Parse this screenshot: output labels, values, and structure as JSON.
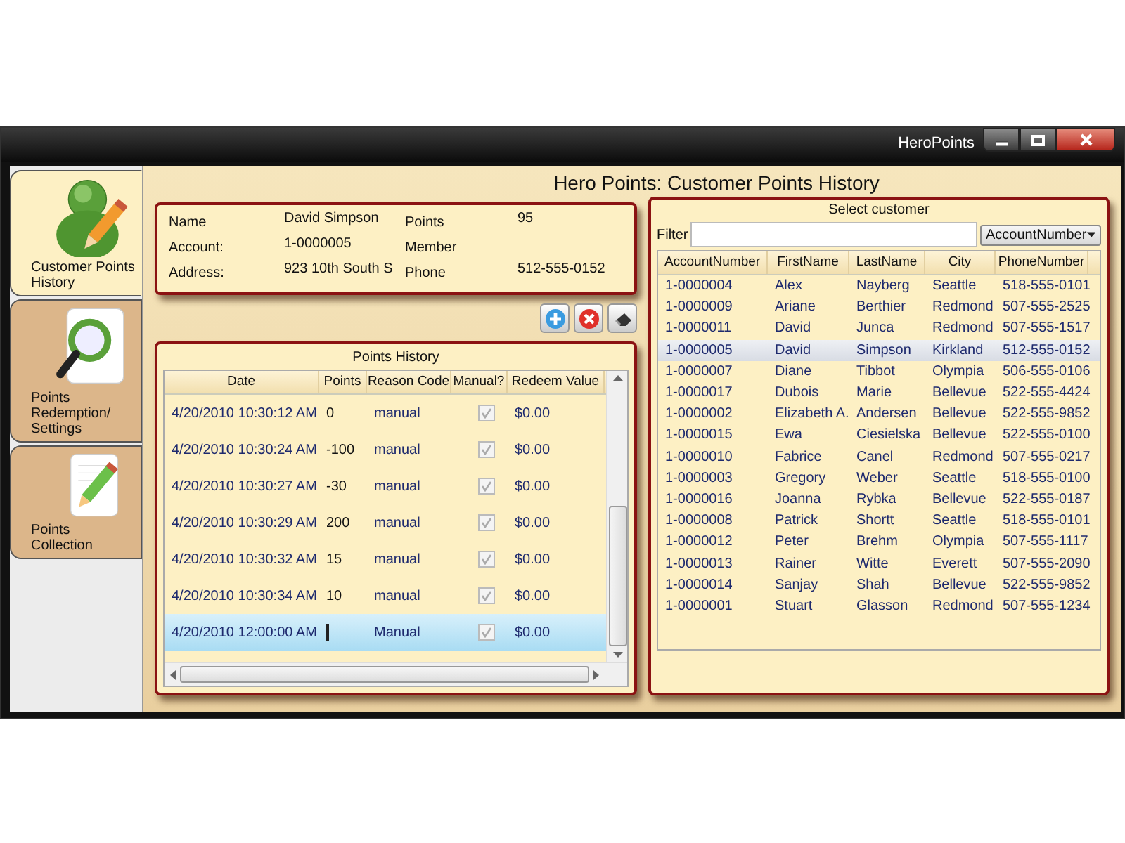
{
  "window": {
    "title": "HeroPoints"
  },
  "nav": [
    {
      "label": "Customer Points History",
      "kind": "person",
      "selected": true
    },
    {
      "label": "Points Redemption/ Settings",
      "kind": "search",
      "selected": false
    },
    {
      "label": "Points Collection",
      "kind": "pencil",
      "selected": false
    }
  ],
  "heading": "Hero Points: Customer Points History",
  "customer": {
    "left": [
      {
        "label": "Name",
        "value": "David Simpson"
      },
      {
        "label": "Account:",
        "value": "1-0000005"
      },
      {
        "label": "Address:",
        "value": "923 10th South S"
      }
    ],
    "right": [
      {
        "label": "Points",
        "value": "95"
      },
      {
        "label": "Member"
      },
      {
        "label": "Phone",
        "value": "512-555-0152"
      }
    ]
  },
  "toolbar": [
    {
      "kind": "add"
    },
    {
      "kind": "delete"
    },
    {
      "kind": "eraser"
    }
  ],
  "points_history": {
    "title": "Points History",
    "columns": [
      "Date",
      "Points",
      "Reason Code",
      "Manual?",
      "Redeem Value"
    ],
    "rows": [
      {
        "date": "4/20/2010 10:30:12 AM",
        "points": "0",
        "reason": "manual",
        "manual": true,
        "redeem": "$0.00",
        "selected": false,
        "editing": false
      },
      {
        "date": "4/20/2010 10:30:24 AM",
        "points": "-100",
        "reason": "manual",
        "manual": true,
        "redeem": "$0.00",
        "selected": false,
        "editing": false
      },
      {
        "date": "4/20/2010 10:30:27 AM",
        "points": "-30",
        "reason": "manual",
        "manual": true,
        "redeem": "$0.00",
        "selected": false,
        "editing": false
      },
      {
        "date": "4/20/2010 10:30:29 AM",
        "points": "200",
        "reason": "manual",
        "manual": true,
        "redeem": "$0.00",
        "selected": false,
        "editing": false
      },
      {
        "date": "4/20/2010 10:30:32 AM",
        "points": "15",
        "reason": "manual",
        "manual": true,
        "redeem": "$0.00",
        "selected": false,
        "editing": false
      },
      {
        "date": "4/20/2010 10:30:34 AM",
        "points": "10",
        "reason": "manual",
        "manual": true,
        "redeem": "$0.00",
        "selected": false,
        "editing": false
      },
      {
        "date": "4/20/2010 12:00:00 AM",
        "reason": "Manual",
        "manual": true,
        "redeem": "$0.00",
        "selected": true,
        "editing": true
      }
    ]
  },
  "customers": {
    "title": "Select customer",
    "filter_label": "Filter",
    "sort_by": "AccountNumber",
    "columns": [
      "AccountNumber",
      "FirstName",
      "LastName",
      "City",
      "PhoneNumber"
    ],
    "rows": [
      {
        "cells": [
          "1-0000004",
          "Alex",
          "Nayberg",
          "Seattle",
          "518-555-0101"
        ],
        "selected": false
      },
      {
        "cells": [
          "1-0000009",
          "Ariane",
          "Berthier",
          "Redmond",
          "507-555-2525"
        ],
        "selected": false
      },
      {
        "cells": [
          "1-0000011",
          "David",
          "Junca",
          "Redmond",
          "507-555-1517"
        ],
        "selected": false
      },
      {
        "cells": [
          "1-0000005",
          "David",
          "Simpson",
          "Kirkland",
          "512-555-0152"
        ],
        "selected": true
      },
      {
        "cells": [
          "1-0000007",
          "Diane",
          "Tibbot",
          "Olympia",
          "506-555-0106"
        ],
        "selected": false
      },
      {
        "cells": [
          "1-0000017",
          "Dubois",
          "Marie",
          "Bellevue",
          "522-555-4424"
        ],
        "selected": false
      },
      {
        "cells": [
          "1-0000002",
          "Elizabeth A.",
          "Andersen",
          "Bellevue",
          "522-555-9852"
        ],
        "selected": false
      },
      {
        "cells": [
          "1-0000015",
          "Ewa",
          "Ciesielska",
          "Bellevue",
          "522-555-0100"
        ],
        "selected": false
      },
      {
        "cells": [
          "1-0000010",
          "Fabrice",
          "Canel",
          "Redmond",
          "507-555-0217"
        ],
        "selected": false
      },
      {
        "cells": [
          "1-0000003",
          "Gregory",
          "Weber",
          "Seattle",
          "518-555-0100"
        ],
        "selected": false
      },
      {
        "cells": [
          "1-0000016",
          "Joanna",
          "Rybka",
          "Bellevue",
          "522-555-0187"
        ],
        "selected": false
      },
      {
        "cells": [
          "1-0000008",
          "Patrick",
          "Shortt",
          "Seattle",
          "518-555-0101"
        ],
        "selected": false
      },
      {
        "cells": [
          "1-0000012",
          "Peter",
          "Brehm",
          "Olympia",
          "507-555-1117"
        ],
        "selected": false
      },
      {
        "cells": [
          "1-0000013",
          "Rainer",
          "Witte",
          "Everett",
          "507-555-2090"
        ],
        "selected": false
      },
      {
        "cells": [
          "1-0000014",
          "Sanjay",
          "Shah",
          "Bellevue",
          "522-555-9852"
        ],
        "selected": false
      },
      {
        "cells": [
          "1-0000001",
          "Stuart",
          "Glasson",
          "Redmond",
          "507-555-1234"
        ],
        "selected": false
      }
    ]
  }
}
